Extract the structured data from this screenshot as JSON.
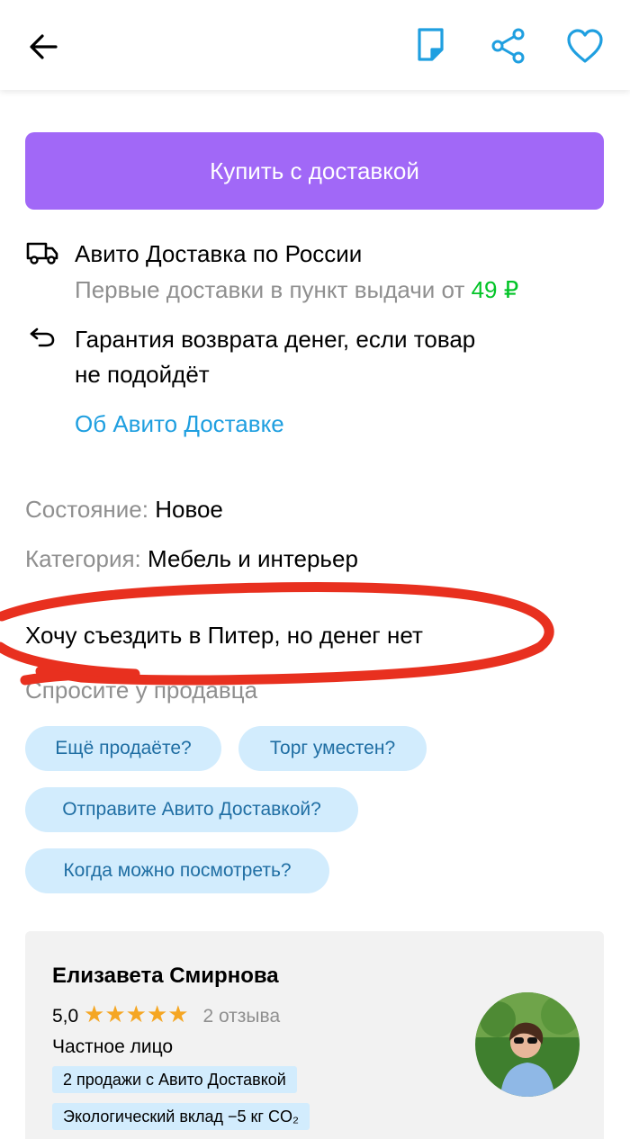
{
  "header": {
    "back_icon": "arrow-left-icon",
    "note_icon": "note-icon",
    "share_icon": "share-icon",
    "favorite_icon": "heart-icon",
    "accent": "#1f9fe0"
  },
  "buy_button": {
    "label": "Купить с доставкой",
    "color": "#a168f7"
  },
  "delivery": {
    "title": "Авито Доставка по России",
    "subtitle_prefix": "Первые доставки в пункт выдачи от",
    "price": "49 ₽",
    "guarantee_line1": "Гарантия возврата денег, если товар",
    "guarantee_line2": "не подойдёт",
    "about_link": "Об Авито Доставке"
  },
  "params": {
    "condition_label": "Состояние:",
    "condition_value": "Новое",
    "category_label": "Категория:",
    "category_value": "Мебель и интерьер"
  },
  "description": "Хочу съездить в Питер, но денег нет",
  "ask_seller": {
    "title": "Спросите у продавца",
    "chips": [
      "Ещё продаёте?",
      "Торг уместен?",
      "Отправите Авито Доставкой?",
      "Когда можно посмотреть?"
    ]
  },
  "seller": {
    "name": "Елизавета Смирнова",
    "rating": "5,0",
    "stars": 5,
    "reviews": "2 отзыва",
    "type": "Частное лицо",
    "badge_sales": "2 продажи с Авито Доставкой",
    "badge_eco": "Экологический вклад −5 кг CO₂"
  }
}
